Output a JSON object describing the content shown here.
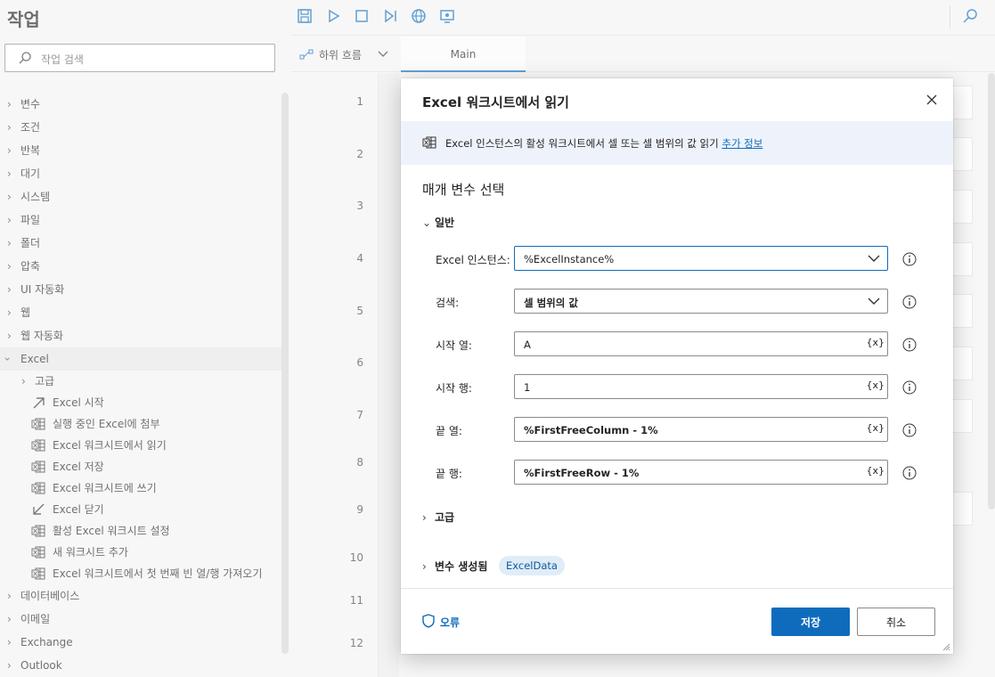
{
  "actions_pane": {
    "title": "작업",
    "search_placeholder": "작업 검색",
    "categories_top": [
      "변수",
      "조건",
      "반복",
      "대기",
      "시스템",
      "파일",
      "폴더",
      "압축",
      "UI 자동화",
      "웹",
      "웹 자동화"
    ],
    "open_category": "Excel",
    "excel_group": "고급",
    "excel_items": [
      {
        "label": "Excel 시작",
        "icon": "arrow-up-right-icon"
      },
      {
        "label": "실행 중인 Excel에 첨부",
        "icon": "excel-icon"
      },
      {
        "label": "Excel 워크시트에서 읽기",
        "icon": "excel-icon"
      },
      {
        "label": "Excel 저장",
        "icon": "excel-icon"
      },
      {
        "label": "Excel 워크시트에 쓰기",
        "icon": "excel-icon"
      },
      {
        "label": "Excel 닫기",
        "icon": "arrow-down-left-icon"
      },
      {
        "label": "활성 Excel 워크시트 설정",
        "icon": "excel-icon"
      },
      {
        "label": "새 워크시트 추가",
        "icon": "excel-icon"
      },
      {
        "label": "Excel 워크시트에서 첫 번째 빈 열/행 가져오기",
        "icon": "excel-icon"
      }
    ],
    "categories_bottom": [
      "데이터베이스",
      "이메일",
      "Exchange",
      "Outlook"
    ]
  },
  "toolbar": {
    "icons": [
      "save-icon",
      "run-icon",
      "stop-icon",
      "run-next-action-icon",
      "web-recorder-icon",
      "desktop-recorder-icon"
    ],
    "search_icon": "search-icon"
  },
  "tabs": {
    "subflows_label": "하위 흐름",
    "main_tab": "Main"
  },
  "canvas": {
    "line_numbers": [
      "1",
      "2",
      "3",
      "4",
      "5",
      "6",
      "7",
      "8",
      "9",
      "10",
      "11",
      "12"
    ]
  },
  "dialog": {
    "title": "Excel 워크시트에서 읽기",
    "description": "Excel 인스턴스의 활성 워크시트에서 셀 또는 셀 범위의 값 읽기",
    "more_info_link": "추가 정보",
    "section_label": "매개 변수 선택",
    "general_header": "일반",
    "fields": [
      {
        "label": "Excel 인스턴스:",
        "value": "%ExcelInstance%",
        "kind": "dropdown"
      },
      {
        "label": "검색:",
        "value": "셀 범위의 값",
        "kind": "dropdown"
      },
      {
        "label": "시작 열:",
        "value": "A",
        "kind": "text"
      },
      {
        "label": "시작 행:",
        "value": "1",
        "kind": "text"
      },
      {
        "label": "끝 열:",
        "value": "%FirstFreeColumn - 1%",
        "kind": "text"
      },
      {
        "label": "끝 행:",
        "value": "%FirstFreeRow - 1%",
        "kind": "text"
      }
    ],
    "variable_button": "{x}",
    "advanced_header": "고급",
    "variables_header": "변수 생성됨",
    "variable_chip": "ExcelData",
    "error_link": "오류",
    "save_label": "저장",
    "cancel_label": "취소"
  },
  "colors": {
    "accent": "#0f6cbd",
    "info_bar": "#eef3fb",
    "chip_bg": "#e0ecf8"
  }
}
